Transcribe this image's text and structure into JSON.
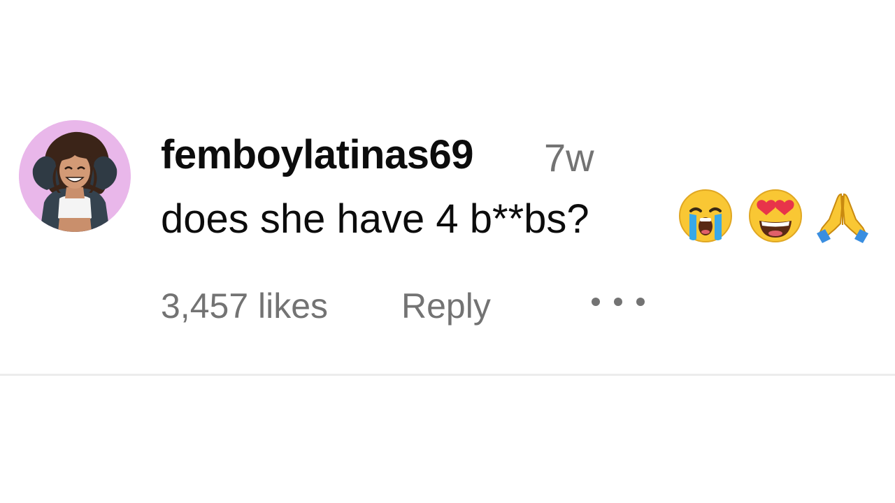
{
  "comment": {
    "username": "femboylatinas69",
    "timestamp": "7w",
    "text": "does she have 4 b**bs?",
    "emoji": [
      "loudly-crying-face",
      "smiling-face-with-heart-eyes",
      "folded-hands"
    ],
    "likes": "3,457 likes",
    "reply_label": "Reply",
    "more_icon": "more-horizontal-icon"
  },
  "colors": {
    "avatar_bg": "#e9b7ea",
    "text_primary": "#0c0c0c",
    "text_secondary": "#737373",
    "divider": "#ececec"
  }
}
